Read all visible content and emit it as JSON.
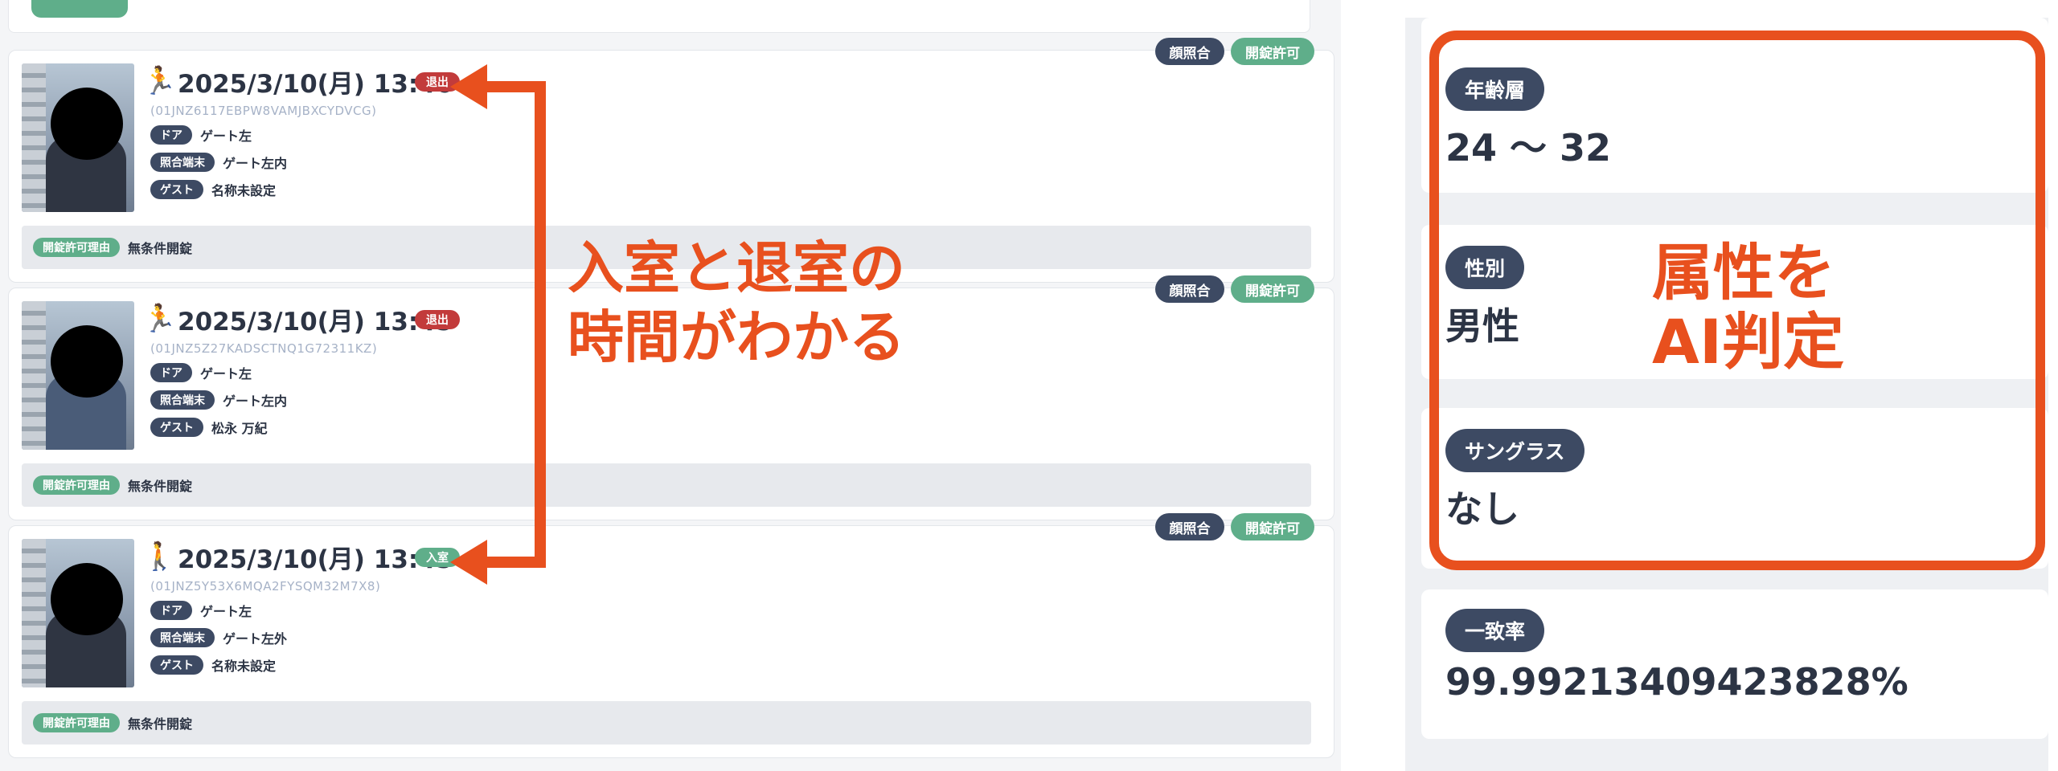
{
  "log": {
    "cards": [
      {
        "tags": {
          "face": "顔照合",
          "unlock": "開錠許可"
        },
        "direction": "exit",
        "icon": "exit-person-icon",
        "datetime": "2025/3/10(月) 13:46",
        "status": "退出",
        "uid": "(01JNZ6117EBPW8VAMJBXCYDVCG)",
        "rows": [
          {
            "label": "ドア",
            "value": "ゲート左"
          },
          {
            "label": "照合端末",
            "value": "ゲート左内"
          },
          {
            "label": "ゲスト",
            "value": "名称未設定"
          }
        ],
        "reason": {
          "label": "開錠許可理由",
          "value": "無条件開錠"
        }
      },
      {
        "tags": {
          "face": "顔照合",
          "unlock": "開錠許可"
        },
        "direction": "exit",
        "icon": "exit-person-icon",
        "datetime": "2025/3/10(月) 13:45",
        "status": "退出",
        "uid": "(01JNZ5Z27KADSCTNQ1G72311KZ)",
        "rows": [
          {
            "label": "ドア",
            "value": "ゲート左"
          },
          {
            "label": "照合端末",
            "value": "ゲート左内"
          },
          {
            "label": "ゲスト",
            "value": "松永 万紀"
          }
        ],
        "reason": {
          "label": "開錠許可理由",
          "value": "無条件開錠"
        }
      },
      {
        "tags": {
          "face": "顔照合",
          "unlock": "開錠許可"
        },
        "direction": "enter",
        "icon": "enter-person-icon",
        "datetime": "2025/3/10(月) 13:45",
        "status": "入室",
        "uid": "(01JNZ5Y53X6MQA2FYSQM32M7X8)",
        "rows": [
          {
            "label": "ドア",
            "value": "ゲート左"
          },
          {
            "label": "照合端末",
            "value": "ゲート左外"
          },
          {
            "label": "ゲスト",
            "value": "名称未設定"
          }
        ],
        "reason": {
          "label": "開錠許可理由",
          "value": "無条件開錠"
        }
      }
    ]
  },
  "annotations": {
    "timing_line1": "入室と退室の",
    "timing_line2": "時間がわかる",
    "attr_line1": "属性を",
    "attr_line2": "AI判定"
  },
  "detail": {
    "age": {
      "label": "年齢層",
      "value": "24 〜 32"
    },
    "gender": {
      "label": "性別",
      "value": "男性"
    },
    "sunglasses": {
      "label": "サングラス",
      "value": "なし"
    },
    "match": {
      "label": "一致率",
      "value": "99.99213409423828%"
    }
  },
  "colors": {
    "annotation": "#e8501e",
    "badge_dark": "#3d4a63",
    "badge_green": "#5fae8a",
    "badge_red": "#c23b3b"
  }
}
